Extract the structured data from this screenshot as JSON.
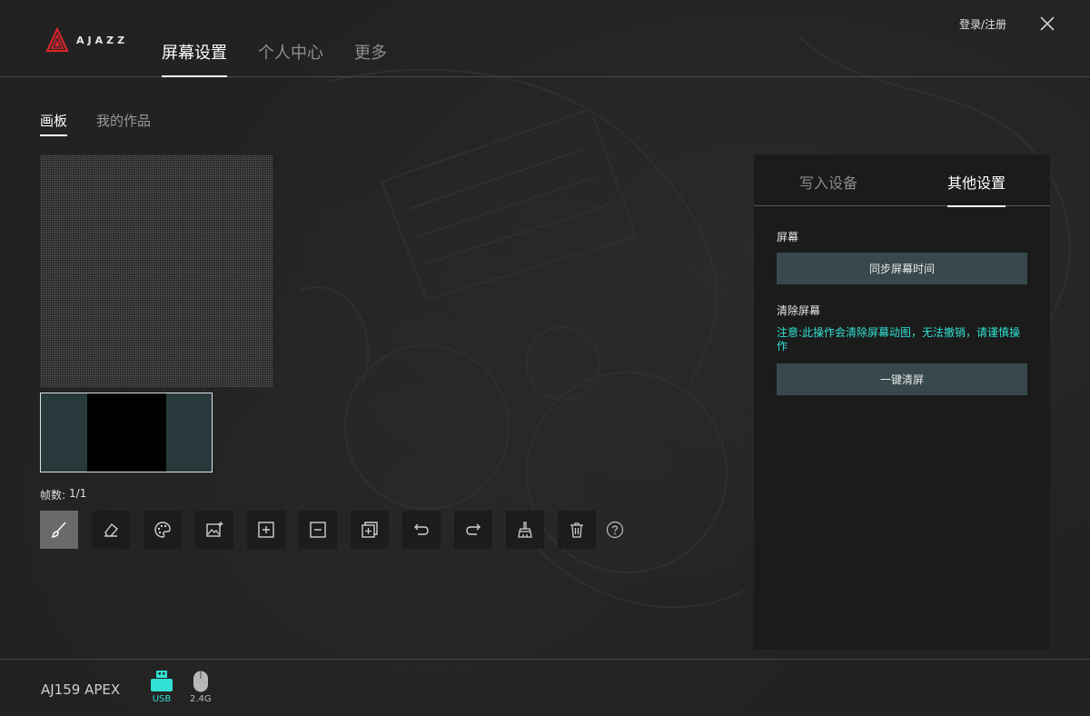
{
  "app": {
    "logo_text": "AJAZZ",
    "login_label": "登录/注册"
  },
  "nav": {
    "items": [
      "屏幕设置",
      "个人中心",
      "更多"
    ]
  },
  "subtabs": [
    "画板",
    "我的作品"
  ],
  "canvas": {
    "frame_label": "帧数:",
    "frame_value": "1/1"
  },
  "toolbar": {
    "tools": [
      "brush-icon",
      "eraser-icon",
      "palette-icon",
      "image-import-icon",
      "add-frame-icon",
      "remove-frame-icon",
      "duplicate-frame-icon",
      "undo-icon",
      "redo-icon",
      "clear-brush-icon",
      "trash-icon",
      "help-icon"
    ]
  },
  "panel": {
    "tabs": [
      "写入设备",
      "其他设置"
    ],
    "screen_label": "屏幕",
    "sync_button": "同步屏幕时间",
    "clear_label": "清除屏幕",
    "warning": "注意:此操作会清除屏幕动图，无法撤销，请谨慎操作",
    "clear_button": "一键清屏"
  },
  "footer": {
    "device_name": "AJ159 APEX",
    "connections": [
      {
        "label": "USB",
        "active": true
      },
      {
        "label": "2.4G",
        "active": false
      }
    ]
  },
  "colors": {
    "accent": "#31e0d2",
    "button_bg": "#37494c",
    "logo_red": "#d7262d"
  }
}
